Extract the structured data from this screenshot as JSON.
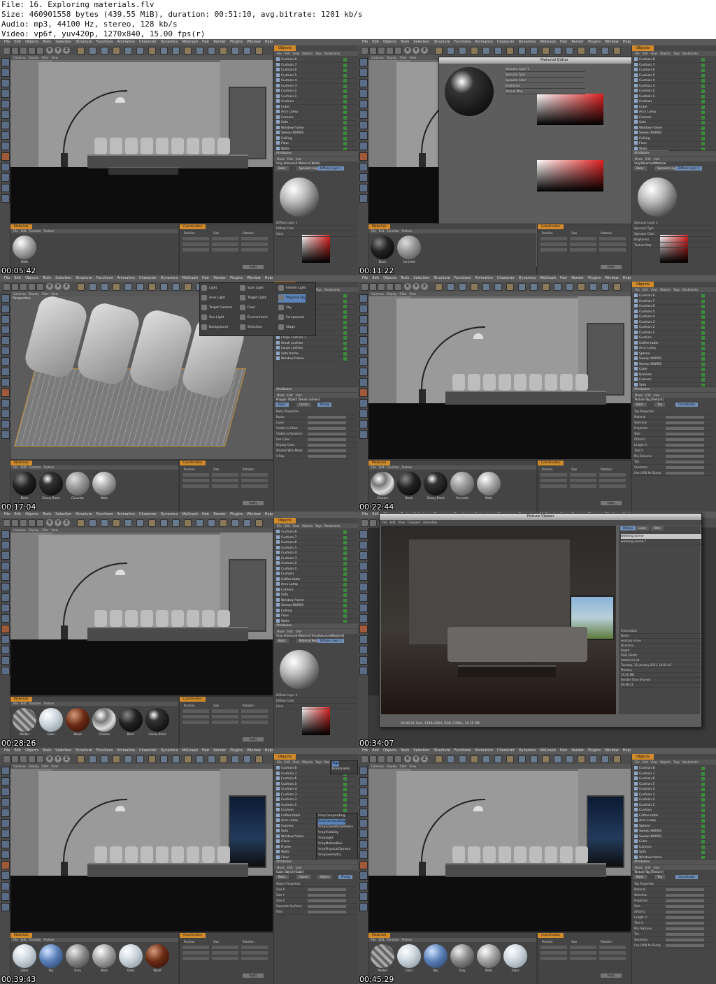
{
  "header": {
    "line1": "File: 16. Exploring materials.flv",
    "line2": "Size: 460901558 bytes (439.55 MiB), duration: 00:51:10, avg.bitrate: 1201 kb/s",
    "line3": "Audio: mp3, 44100 Hz, stereo, 128 kb/s",
    "line4": "Video: vp6f, yuv420p, 1270x840, 15.00 fps(r)"
  },
  "app_menu": [
    "File",
    "Edit",
    "Objects",
    "Tools",
    "Selection",
    "Structure",
    "Functions",
    "Animation",
    "Character",
    "Dynamics",
    "MoGraph",
    "Hair",
    "Render",
    "Plugins",
    "Window",
    "Help"
  ],
  "viewport_menu": [
    "Cameras",
    "Display",
    "Filter",
    "View"
  ],
  "viewport_label": "Perspective",
  "objects_tab": "Objects",
  "objects_menu": [
    "File",
    "Edit",
    "View",
    "Objects",
    "Tags",
    "Bookmarks"
  ],
  "attributes_tab": "Attributes",
  "attributes_menu": [
    "Mode",
    "Edit",
    "User"
  ],
  "materials_tab": "Materials",
  "materials_menu": [
    "File",
    "Edit",
    "Function",
    "Texture"
  ],
  "coordinates_tab": "Coordinates",
  "coordinates_cols": [
    "Position",
    "Size",
    "Rotation"
  ],
  "apply_label": "Apply",
  "colors": {
    "accent_tab": "#d08a2a",
    "ui_dark": "#474747",
    "highlight_blue": "#5b83b8"
  },
  "frames": [
    {
      "timestamp": "00:05:42",
      "objects": [
        "Cushion.8",
        "Cushion.7",
        "Cushion.6",
        "Cushion.5",
        "Cushion.4",
        "Cushion.3",
        "Cushion.2",
        "Cushion.1",
        "Cushion",
        "Cube",
        "Arco Lamp",
        "Camera",
        "Sofa",
        "Window frame",
        "Sweep NURBS",
        "Ceiling",
        "Floor",
        "Walls"
      ],
      "attr_title": "Vray Advanced Material [Walls]",
      "attr_tabs": [
        "Basic",
        "Specular Layer 1",
        "Diffuse Layer 1"
      ],
      "attr_fields": [
        "Diffuse Layer 1",
        "Diffuse Color",
        "Color"
      ],
      "materials": [
        "Walls"
      ]
    },
    {
      "timestamp": "00:11:22",
      "dialog": "Material Editor",
      "objects": [
        "Cushion.8",
        "Cushion.7",
        "Cushion.6",
        "Cushion.5",
        "Cushion.4",
        "Cushion.3",
        "Cushion.2",
        "Cushion.1",
        "Cushion",
        "Cube",
        "Arco Lamp",
        "Camera",
        "Sofa",
        "Window frame",
        "Sweep NURBS",
        "Ceiling",
        "Floor",
        "Walls"
      ],
      "attr_title": "VrayAdvancedMaterial",
      "attr_tabs": [
        "Basic",
        "Specular Layer 1",
        "Diffuse Layer 1"
      ],
      "attr_fields": [
        "Specular Layer 1",
        "Specular Type",
        "Specular Color",
        "Brightness",
        "Texture Map"
      ],
      "materials": [
        "Black",
        "Concrete"
      ]
    },
    {
      "timestamp": "00:17:04",
      "popup": [
        "Light",
        "Spot Light",
        "Infinite Light",
        "Area Light",
        "Target Light",
        "Physical Sky",
        "Target Camera",
        "Floor",
        "Sky",
        "Sun Light",
        "Environment",
        "Foreground",
        "Background",
        "Selection",
        "Stage"
      ],
      "objects": [
        "Cushion.8",
        "Cushion.7",
        "Cushion.6",
        "Back2",
        "Back1",
        "Back3",
        "Back4",
        "Small cushion",
        "Large cushion.1",
        "Small cushion",
        "Large cushion",
        "Sofa frame",
        "Window frame"
      ],
      "attr_title": "Polygon Object [Small cushion]",
      "attr_tabs": [
        "Basic",
        "Coord.",
        "Phong"
      ],
      "attr_fields": [
        "Basic Properties",
        "Name",
        "Layer",
        "Visible in Editor",
        "Visible in Renderer",
        "Use Color",
        "Display Color",
        "Shaded Wire Mode",
        "X-Ray"
      ],
      "materials": [
        "Black",
        "Glossy Black",
        "Concrete",
        "Walls"
      ]
    },
    {
      "timestamp": "00:22:44",
      "objects": [
        "Cushion.8",
        "Cushion.7",
        "Cushion.6",
        "Cushion.5",
        "Cushion.4",
        "Cushion.3",
        "Cushion.2",
        "Cushion.1",
        "Cushion",
        "Coffee table",
        "Arco Lamp",
        "Sphere",
        "Sweep NURBS",
        "Sweep NURBS",
        "Cube",
        "Boolean",
        "Camera",
        "Sofa"
      ],
      "attr_title": "Texture Tag [Texture]",
      "attr_tabs": [
        "Basic",
        "Tag",
        "Coordinates"
      ],
      "attr_fields": [
        "Tag Properties",
        "Material",
        "Selection",
        "Projection",
        "Side",
        "Offset U",
        "Length U",
        "Tiles U",
        "Mix Textures",
        "Tile",
        "Seamless",
        "Use UVW for Bump"
      ],
      "materials": [
        "Chrome",
        "Black",
        "Glossy Black",
        "Concrete",
        "Walls"
      ]
    },
    {
      "timestamp": "00:28:26",
      "objects": [
        "Cushion.8",
        "Cushion.7",
        "Cushion.6",
        "Cushion.5",
        "Cushion.4",
        "Cushion.3",
        "Cushion.2",
        "Cushion.1",
        "Cushion",
        "Coffee table",
        "Arco Lamp",
        "Camera",
        "Sofa",
        "Window frame",
        "Sweep NURBS",
        "Ceiling",
        "Floor",
        "Walls"
      ],
      "attr_title": "Vray Advanced Material [VrayAdvancedMaterial]",
      "attr_tabs": [
        "Basic",
        "Material Weight",
        "Diffuse Layer 1"
      ],
      "attr_fields": [
        "Diffuse Layer 1",
        "Diffuse Color",
        "Color"
      ],
      "materials": [
        "Marble",
        "Glass",
        "Wood",
        "Chrome",
        "Black",
        "Glossy Black"
      ]
    },
    {
      "timestamp": "00:34:07",
      "dialog": "Picture Viewer",
      "pv_menu": [
        "File",
        "Edit",
        "View",
        "Compare",
        "Animation"
      ],
      "pv_tabs": [
        "History",
        "Layer",
        "Filter"
      ],
      "pv_history": [
        "working scene",
        "working scene *"
      ],
      "pv_info": [
        "Information",
        "Name",
        "working scene",
        "Directory",
        "Depth",
        "RGB (32bit)",
        "Added to List",
        "Tuesday, 11 January 2011, 18:01:45",
        "Memory",
        "15.55 MB",
        "Render Time (Frame)",
        "00:08:21"
      ],
      "pv_status": "00:08:21  Size: 1280x1024, RGB (32Bit), 15.55 MB"
    },
    {
      "timestamp": "00:39:43",
      "popup": [
        "Tags",
        "Bookmarks"
      ],
      "popup2": [
        "VrayCompositing",
        "VrayCompositing",
        "VraySceneParameters",
        "VrayVisibility",
        "VrayLight",
        "VrayMotionBlur",
        "VrayPhysicalCamera",
        "VrayGeometry"
      ],
      "objects": [
        "Cushion.8",
        "Cushion.7",
        "Cushion.6",
        "Cushion.5",
        "Cushion.4",
        "Cushion.3",
        "Cushion.2",
        "Cushion.1",
        "Cushion",
        "Coffee table",
        "Arco Lamp",
        "Camera",
        "Sofa",
        "Window frame",
        "Glass",
        "Frame",
        "Walls",
        "Floor"
      ],
      "attr_title": "Cube Object [Cube]",
      "attr_tabs": [
        "Basic",
        "Coord.",
        "Object",
        "Phong"
      ],
      "attr_fields": [
        "Object Properties",
        "Size X",
        "Size Y",
        "Size Z",
        "Separate Surfaces",
        "Fillet"
      ],
      "materials": [
        "Glass",
        "Sky",
        "Grey",
        "Walls",
        "Glass",
        "Wood"
      ]
    },
    {
      "timestamp": "00:45:29",
      "objects": [
        "Cushion.8",
        "Cushion.7",
        "Cushion.6",
        "Cushion.5",
        "Cushion.4",
        "Cushion.3",
        "Cushion.2",
        "Cushion.1",
        "Cushion",
        "Coffee table",
        "Arco Lamp",
        "Sphere",
        "Sweep NURBS",
        "Sweep NURBS",
        "Cube",
        "Camera",
        "Sofa",
        "Window frame"
      ],
      "attr_title": "Texture Tag [Texture]",
      "attr_tabs": [
        "Basic",
        "Tag",
        "Coordinates"
      ],
      "attr_fields": [
        "Tag Properties",
        "Material",
        "Selection",
        "Projection",
        "Side",
        "Offset U",
        "Length U",
        "Tiles U",
        "Mix Textures",
        "Tile",
        "Seamless",
        "Use UVW for Bump"
      ],
      "materials": [
        "Marble",
        "Glass",
        "Sky",
        "Grey",
        "Walls",
        "Glass"
      ]
    }
  ]
}
